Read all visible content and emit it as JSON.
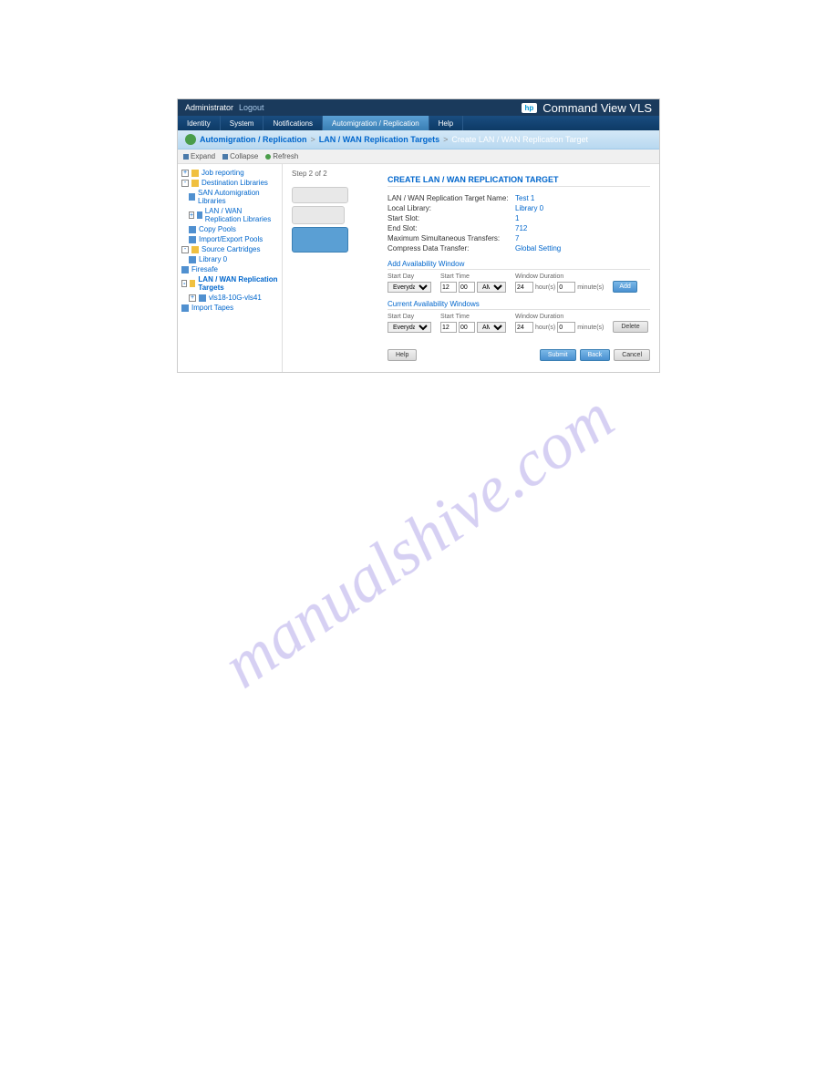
{
  "topbar": {
    "user": "Administrator",
    "logout": "Logout",
    "logo": "hp",
    "product": "Command View VLS"
  },
  "tabs": {
    "items": [
      "Identity",
      "System",
      "Notifications",
      "Automigration / Replication",
      "Help"
    ],
    "active_index": 3
  },
  "breadcrumb": {
    "items": [
      "Automigration / Replication",
      "LAN / WAN Replication Targets",
      "Create LAN / WAN Replication Target"
    ]
  },
  "toolbar": {
    "expand": "Expand",
    "collapse": "Collapse",
    "refresh": "Refresh",
    "step": "Step 2 of 2"
  },
  "sidebar": {
    "items": [
      {
        "label": "Job reporting",
        "level": 0,
        "toggle": "+"
      },
      {
        "label": "Destination Libraries",
        "level": 0,
        "toggle": "-"
      },
      {
        "label": "SAN Automigration Libraries",
        "level": 1
      },
      {
        "label": "LAN / WAN Replication Libraries",
        "level": 1,
        "toggle": "+"
      },
      {
        "label": "Copy Pools",
        "level": 1
      },
      {
        "label": "Import/Export Pools",
        "level": 1
      },
      {
        "label": "Source Cartridges",
        "level": 0,
        "toggle": "-"
      },
      {
        "label": "Library 0",
        "level": 1
      },
      {
        "label": "Firesafe",
        "level": 0
      },
      {
        "label": "LAN / WAN Replication Targets",
        "level": 0,
        "toggle": "-",
        "active": true
      },
      {
        "label": "vls18-10G-vls41",
        "level": 1,
        "toggle": "+"
      },
      {
        "label": "Import Tapes",
        "level": 0
      }
    ]
  },
  "panel": {
    "title": "CREATE LAN / WAN REPLICATION TARGET",
    "rows": [
      {
        "label": "LAN / WAN Replication Target Name:",
        "value": "Test 1"
      },
      {
        "label": "Local Library:",
        "value": "Library 0"
      },
      {
        "label": "Start Slot:",
        "value": "1"
      },
      {
        "label": "End Slot:",
        "value": "712"
      },
      {
        "label": "Maximum Simultaneous Transfers:",
        "value": "7"
      },
      {
        "label": "Compress Data Transfer:",
        "value": "Global Setting"
      }
    ]
  },
  "add_window": {
    "header": "Add Availability Window",
    "start_day_label": "Start Day",
    "start_day_value": "Everyday",
    "start_time_label": "Start Time",
    "hour": "12",
    "minute": "00",
    "ampm": "AM",
    "duration_label": "Window Duration",
    "hours": "24",
    "hours_unit": "hour(s)",
    "minutes": "0",
    "minutes_unit": "minute(s)",
    "add_btn": "Add"
  },
  "current_window": {
    "header": "Current Availability Windows",
    "start_day_label": "Start Day",
    "start_day_value": "Everyday",
    "start_time_label": "Start Time",
    "hour": "12",
    "minute": "00",
    "ampm": "AM",
    "duration_label": "Window Duration",
    "hours": "24",
    "hours_unit": "hour(s)",
    "minutes": "0",
    "minutes_unit": "minute(s)",
    "delete_btn": "Delete"
  },
  "buttons": {
    "help": "Help",
    "submit": "Submit",
    "back": "Back",
    "cancel": "Cancel"
  },
  "watermark": "manualshive.com"
}
